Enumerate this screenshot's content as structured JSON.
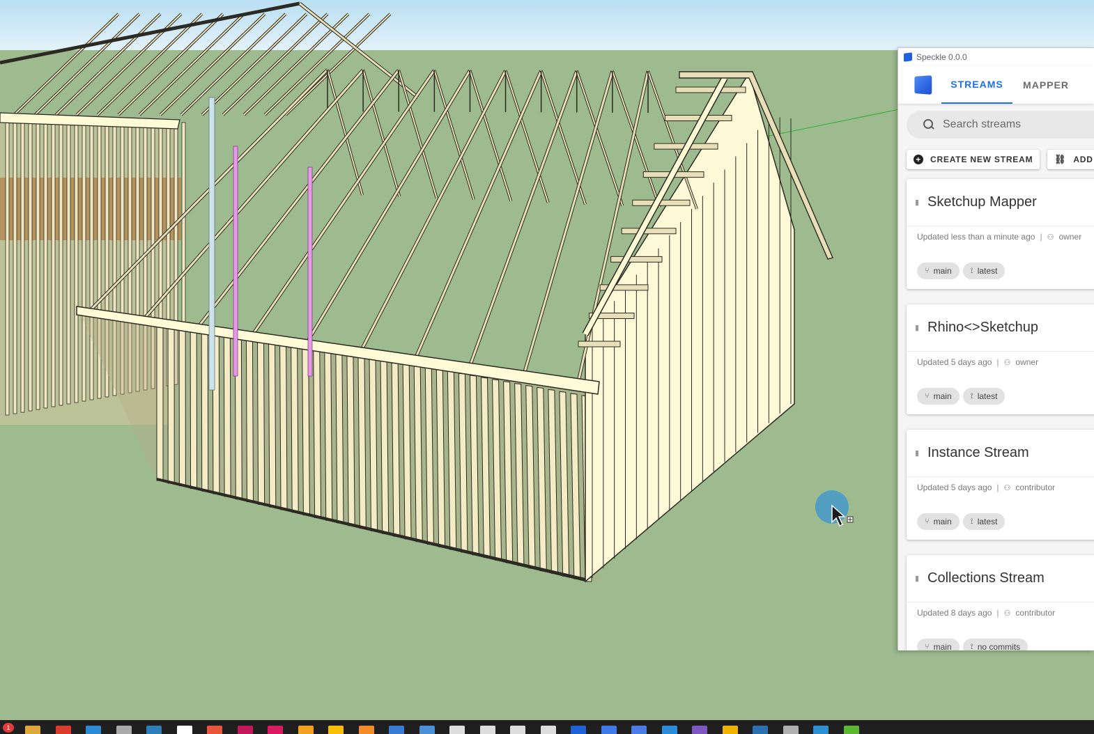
{
  "app": {
    "window_title": "Speckle 0.0.0",
    "tabs": [
      {
        "label": "STREAMS",
        "active": true
      },
      {
        "label": "MAPPER",
        "active": false
      }
    ]
  },
  "search": {
    "placeholder": "Search streams",
    "icon": "search-icon"
  },
  "actions": {
    "create_label": "CREATE NEW STREAM",
    "add_label": "ADD"
  },
  "streams": [
    {
      "name": "Sketchup Mapper",
      "updated": "Updated less than a minute ago",
      "role": "owner",
      "branch": "main",
      "commit": "latest"
    },
    {
      "name": "Rhino<>Sketchup",
      "updated": "Updated 5 days ago",
      "role": "owner",
      "branch": "main",
      "commit": "latest"
    },
    {
      "name": "Instance Stream",
      "updated": "Updated 5 days ago",
      "role": "contributor",
      "branch": "main",
      "commit": "latest"
    },
    {
      "name": "Collections Stream",
      "updated": "Updated 8 days ago",
      "role": "contributor",
      "branch": "main",
      "commit": "no commits"
    }
  ],
  "taskbar": {
    "notification_count": "1"
  },
  "colors": {
    "accent": "#1e6fe8",
    "viewport_ground": "#9dbb8f",
    "sky": "#d6ecf7",
    "timber": "#e8dfb8",
    "timber_light": "#fffbd6",
    "taskbar": "#1f1f1f"
  }
}
